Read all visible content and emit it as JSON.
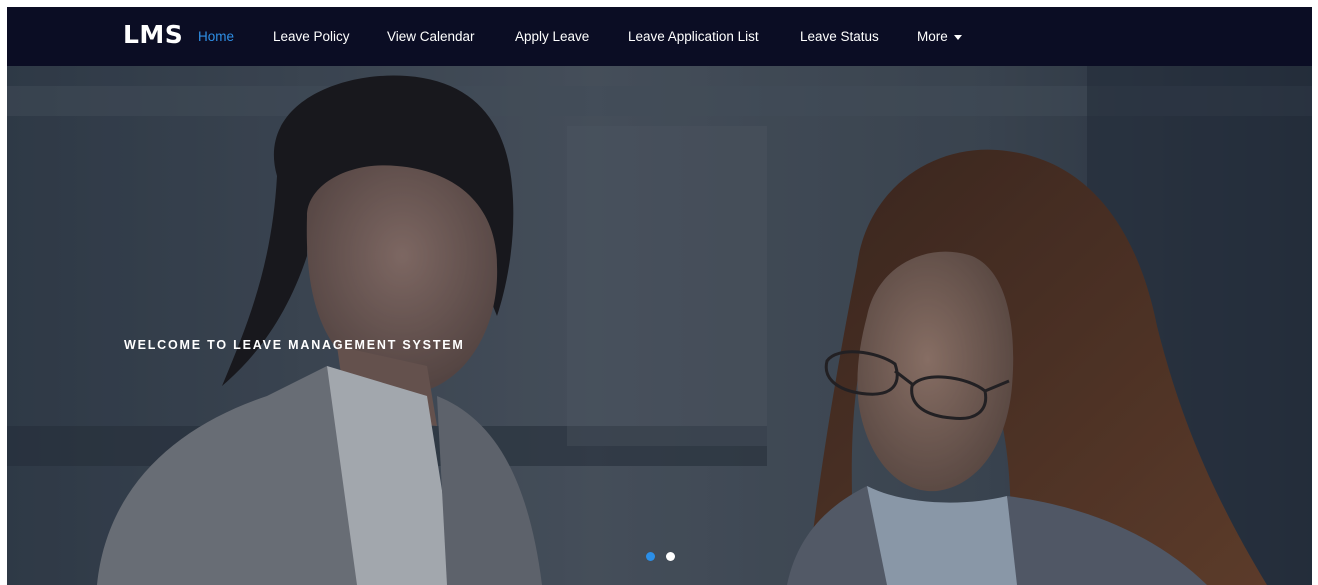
{
  "navbar": {
    "brand": "LMS",
    "links": [
      {
        "label": "Home",
        "active": true
      },
      {
        "label": "Leave Policy"
      },
      {
        "label": "View Calendar"
      },
      {
        "label": "Apply Leave"
      },
      {
        "label": "Leave Application List"
      },
      {
        "label": "Leave Status"
      },
      {
        "label": "More",
        "icon": "caret-down-icon"
      }
    ]
  },
  "hero": {
    "caption": "WELCOME TO LEAVE MANAGEMENT SYSTEM",
    "slide_count": 2,
    "active_slide": 1,
    "image_subject": "two businesswomen reviewing documents"
  },
  "colors": {
    "navbar_bg": "#0b0d24",
    "active_link": "#2f8fe6",
    "indicator_active": "#2b8fe8",
    "indicator_inactive": "#ffffff"
  }
}
